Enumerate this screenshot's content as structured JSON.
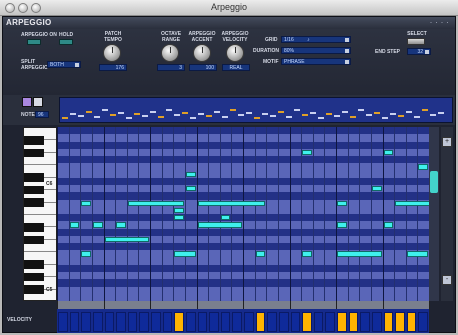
{
  "window": {
    "title": "Arpeggio"
  },
  "panel": {
    "title": "ARPEGGIO",
    "header_dots": "· · · ·"
  },
  "controls": {
    "arpeggio_on_label": "ARPEGGIO ON",
    "hold_label": "HOLD",
    "split_label": "SPLIT\nARPEGGIO",
    "split_value": "BOTH",
    "patch_tempo_label": "PATCH\nTEMPO",
    "patch_tempo_value": "176",
    "octave_range_label": "OCTAVE\nRANGE",
    "octave_range_value": "3",
    "arpeggio_accent_label": "ARPEGGIO\nACCENT",
    "arpeggio_accent_value": "100",
    "arpeggio_velocity_label": "ARPEGGIO\nVELOCITY",
    "arpeggio_velocity_value": "REAL",
    "grid_label": "GRID",
    "grid_value": "1/16",
    "grid_suffix": "♪",
    "duration_label": "DURATION",
    "duration_value": "80%",
    "motif_label": "MOTIF",
    "motif_value": "PHRASE",
    "select_label": "SELECT",
    "end_step_label": "END STEP",
    "end_step_value": "32"
  },
  "toolbar": {
    "note_label": "NOTE",
    "note_value": "96"
  },
  "keyboard": {
    "labels": [
      "C6",
      "C5"
    ]
  },
  "velocity": {
    "label": "VELOCITY"
  },
  "colors": {
    "accent": "#3ff0ec",
    "panel": "#1f2330",
    "grid": "#2c3e9e",
    "velocity_on": "#ffb400"
  }
}
